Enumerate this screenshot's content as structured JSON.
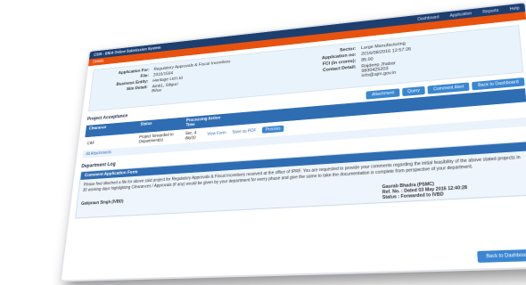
{
  "topbar": {
    "brand": "CSIS - BIDA Online Submission System",
    "nav": [
      "Dashboard",
      "Application",
      "Reports",
      "Help"
    ]
  },
  "orangebar": {
    "label": "Details"
  },
  "info": {
    "left": [
      {
        "k": "Application For:",
        "v": [
          "Regulatory Approvals & Fiscal Incentives"
        ]
      },
      {
        "k": "File:",
        "v": [
          "2016/1504"
        ]
      },
      {
        "k": "Business Entity:",
        "v": [
          "Heritage Ltd Ltd"
        ]
      },
      {
        "k": "Site Detail:",
        "v": [
          "Amb1, Siliguri",
          "Bihar"
        ]
      }
    ],
    "right": [
      {
        "k": "Sector:",
        "v": [
          "Large Manufacturing"
        ]
      },
      {
        "k": "Application no:",
        "v": [
          "2016/08/2016 12:57:26"
        ]
      },
      {
        "k": "FCI (in crores):",
        "v": [
          "85.00"
        ]
      },
      {
        "k": "Contact Detail:",
        "v": [
          "Rajdeep Jhabar",
          "9830425203",
          "info@ajm.gov.in"
        ]
      }
    ]
  },
  "acceptance": {
    "title": "Project Acceptance",
    "buttons": [
      "Attachment",
      "Query",
      "Comment Alert",
      "Back to Dashboard"
    ],
    "headers": [
      "Clearance",
      "Status",
      "Processing Time",
      "Action"
    ],
    "rows": [
      {
        "clearance": "CAF",
        "status": "Project forwarded to Department(s)",
        "time": "Sec. 4 day(s)",
        "view": "View Form",
        "pdf": "Save as PDF",
        "action": "Process"
      }
    ],
    "all_link": "All Attachments"
  },
  "log": {
    "title": "Department Log",
    "box_title": "Comment Application Form",
    "body": "Please find attached a file for above said project for Regulatory Approvals & Fiscal Incentives received at the office of IPRF. You are requested to provide your comments regarding the initial feasibility of the above stated projects in 30 working days highlighting Clearances / Approvals (if any) would be given by your department for every phase and give the same to take the documentation is complete from perspective of your department.",
    "signer": "Gatipraun Singh (IVBD)",
    "right_lines": [
      "Gaurab Bhadra (PSMC)",
      "Ref. No. : Dated 03 May 2016 12:40:28",
      "Status : Forwarded to IVBD"
    ]
  },
  "footer": {
    "back": "Back to Dashboard"
  }
}
